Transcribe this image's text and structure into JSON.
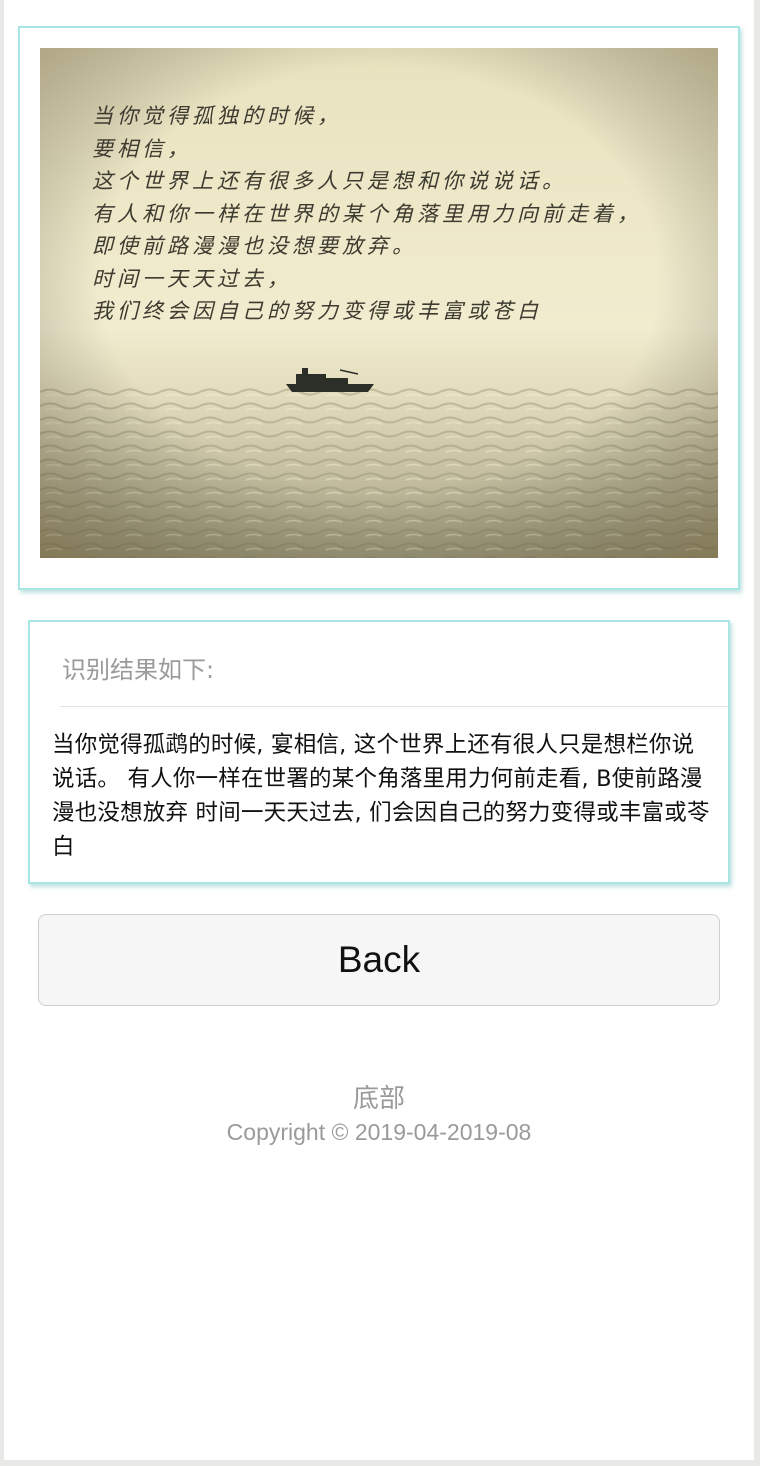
{
  "photo": {
    "poem_lines": [
      "当你觉得孤独的时候，",
      "要相信，",
      "这个世界上还有很多人只是想和你说说话。",
      "有人和你一样在世界的某个角落里用力向前走着，",
      "即使前路漫漫也没想要放弃。",
      "时间一天天过去，",
      "我们终会因自己的努力变得或丰富或苍白"
    ]
  },
  "result": {
    "title": "识别结果如下:",
    "text": "当你觉得孤鹉的时候, 宴相信, 这个世界上还有很人只是想栏你说说话。 有人你一样在世署的某个角落里用力何前走看, B使前路漫漫也没想放弃 时间一天天过去, 们会因自己的努力变得或丰富或苓白"
  },
  "back_button": {
    "label": "Back"
  },
  "footer": {
    "title": "底部",
    "copyright": "Copyright © 2019-04-2019-08"
  }
}
